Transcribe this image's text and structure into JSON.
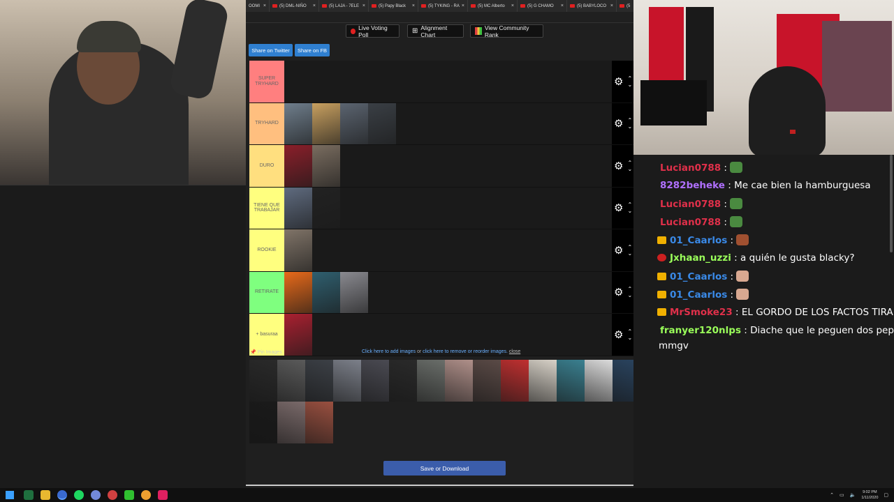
{
  "browser": {
    "tabs": [
      {
        "label": "OOMI"
      },
      {
        "label": "(5) DML-NIÑO"
      },
      {
        "label": "(5) LAJA - 7ELE"
      },
      {
        "label": "(5) Papy Black"
      },
      {
        "label": "(5) TYKING - RA"
      },
      {
        "label": "(5) MC Alberto"
      },
      {
        "label": "(5) G CHAMO"
      },
      {
        "label": "(5) BABYLOCO"
      },
      {
        "label": "(5"
      }
    ]
  },
  "toolbar": {
    "live_voting": "Live Voting Poll",
    "alignment": "Alignment Chart",
    "community_rank": "View Community Rank",
    "share_twitter": "Share on Twitter",
    "share_fb": "Share on FB"
  },
  "tiers": [
    {
      "label": "SUPER TRYHARD",
      "color": "#ff7f7f"
    },
    {
      "label": "TRYHARD",
      "color": "#ffbf7f"
    },
    {
      "label": "DURO",
      "color": "#ffdf7f"
    },
    {
      "label": "TIENE QUE TRABAJAR",
      "color": "#ffff7f"
    },
    {
      "label": "ROOKIE",
      "color": "#ffff7f"
    },
    {
      "label": "RETIRATE",
      "color": "#7fff7f"
    },
    {
      "label": "+ basuraa",
      "color": "#ffff7f"
    }
  ],
  "tier_items": [
    [],
    [
      "#6f7e8c",
      "#c8a060",
      "#5b6470",
      "#3a3f45"
    ],
    [
      "#8b1f2a",
      "#7a6d60"
    ],
    [
      "#5f6b7f",
      "#222222"
    ],
    [
      "#807468"
    ],
    [
      "#e86a1a",
      "#2f5f6f",
      "#8a8a90"
    ],
    [
      "#aa2030"
    ]
  ],
  "pool": {
    "pin_label": "Pin Images",
    "add_link": "Click here to add images",
    "or_text": " or ",
    "remove_link": "click here to remove or reorder images.",
    "close_link": "close",
    "images": [
      "#2a2a2a",
      "#5a5a5a",
      "#3c4046",
      "#7c808a",
      "#4a4a52",
      "#2a2a2a",
      "#6a6e6a",
      "#b0908a",
      "#5a4a46",
      "#c03030",
      "#d8d2c8",
      "#3a8090",
      "#dcdcdc",
      "#2a4460",
      "#1a1a1a",
      "#7a6a6a",
      "#9a5040"
    ]
  },
  "save_button": "Save or Download",
  "chat": {
    "messages": [
      {
        "user": "Lucian0788",
        "color": "#e0304a",
        "text": "",
        "badge": "",
        "emote": "#4a8a40"
      },
      {
        "user": "8282beheke",
        "color": "#b070ff",
        "text": " Me cae bien la hamburguesa",
        "badge": "",
        "emote": ""
      },
      {
        "user": "Lucian0788",
        "color": "#e0304a",
        "text": "",
        "badge": "",
        "emote": "#4a8a40"
      },
      {
        "user": "Lucian0788",
        "color": "#e0304a",
        "text": "",
        "badge": "",
        "emote": "#4a8a40"
      },
      {
        "user": "01_Caarlos",
        "color": "#3a8ae8",
        "text": "",
        "badge": "#f0b000",
        "emote": "#a05030"
      },
      {
        "user": "Jxhaan_uzzi",
        "color": "#9aff5a",
        "text": " a quién le gusta blacky?",
        "badge": "#cc2020",
        "emote": ""
      },
      {
        "user": "01_Caarlos",
        "color": "#3a8ae8",
        "text": "",
        "badge": "#f0b000",
        "emote": "#d8a890"
      },
      {
        "user": "01_Caarlos",
        "color": "#3a8ae8",
        "text": "",
        "badge": "#f0b000",
        "emote": "#d8a890"
      },
      {
        "user": "MrSmoke23",
        "color": "#e0304a",
        "text": " EL GORDO DE LOS FACTOS TIRANDO",
        "badge": "#f0b000",
        "emote": ""
      },
      {
        "user": "franyer120nlps",
        "color": "#9aff5a",
        "text": " Diache que le peguen dos pepatos e",
        "badge": "",
        "emote": ""
      }
    ],
    "wrap_text": "mmgv"
  },
  "taskbar": {
    "time": "9:02 PM",
    "date": "1/11/2020"
  }
}
